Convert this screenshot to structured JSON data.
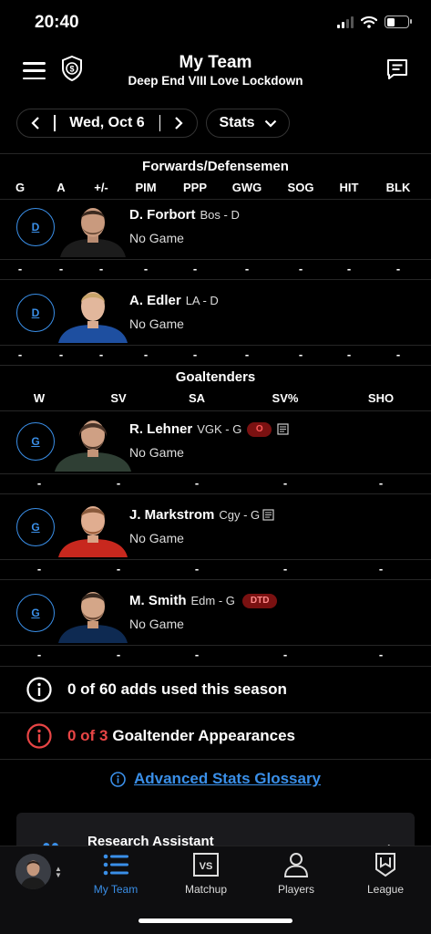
{
  "status_bar": {
    "time": "20:40"
  },
  "header": {
    "title": "My Team",
    "subtitle": "Deep End VIII Love Lockdown"
  },
  "controls": {
    "date": "Wed, Oct 6",
    "stats_label": "Stats"
  },
  "skaters": {
    "title": "Forwards/Defensemen",
    "columns": [
      "G",
      "A",
      "+/-",
      "PIM",
      "PPP",
      "GWG",
      "SOG",
      "HIT",
      "BLK"
    ],
    "players": [
      {
        "position": "D",
        "name": "D. Forbort",
        "team": "Bos - D",
        "status": "No Game",
        "stats": [
          "-",
          "-",
          "-",
          "-",
          "-",
          "-",
          "-",
          "-",
          "-"
        ]
      },
      {
        "position": "D",
        "name": "A. Edler",
        "team": "LA - D",
        "status": "No Game",
        "stats": [
          "-",
          "-",
          "-",
          "-",
          "-",
          "-",
          "-",
          "-",
          "-"
        ]
      }
    ]
  },
  "goalies": {
    "title": "Goaltenders",
    "columns": [
      "W",
      "SV",
      "SA",
      "SV%",
      "SHO"
    ],
    "players": [
      {
        "position": "G",
        "name": "R. Lehner",
        "team": "VGK - G",
        "badge": "O",
        "status": "No Game",
        "stats": [
          "-",
          "-",
          "-",
          "-",
          "-"
        ]
      },
      {
        "position": "G",
        "name": "J. Markstrom",
        "team": "Cgy - G",
        "status": "No Game",
        "stats": [
          "-",
          "-",
          "-",
          "-",
          "-"
        ]
      },
      {
        "position": "G",
        "name": "M. Smith",
        "team": "Edm - G",
        "badge": "DTD",
        "status": "No Game",
        "stats": [
          "-",
          "-",
          "-",
          "-",
          "-"
        ]
      }
    ]
  },
  "info": {
    "adds": "0 of 60 adds used this season",
    "goalie_count": "0 of 3",
    "goalie_label": "Goaltender Appearances",
    "glossary": "Advanced Stats Glossary"
  },
  "research": {
    "title": "Research Assistant"
  },
  "tabs": [
    {
      "label": "My Team",
      "icon": "list-icon",
      "active": true
    },
    {
      "label": "Matchup",
      "icon": "vs-icon",
      "active": false
    },
    {
      "label": "Players",
      "icon": "person-icon",
      "active": false
    },
    {
      "label": "League",
      "icon": "league-shield-icon",
      "active": false
    }
  ],
  "colors": {
    "accent": "#3a8fe8",
    "alert": "#e84545",
    "badge_bg": "#7a1111",
    "background": "#000000"
  }
}
